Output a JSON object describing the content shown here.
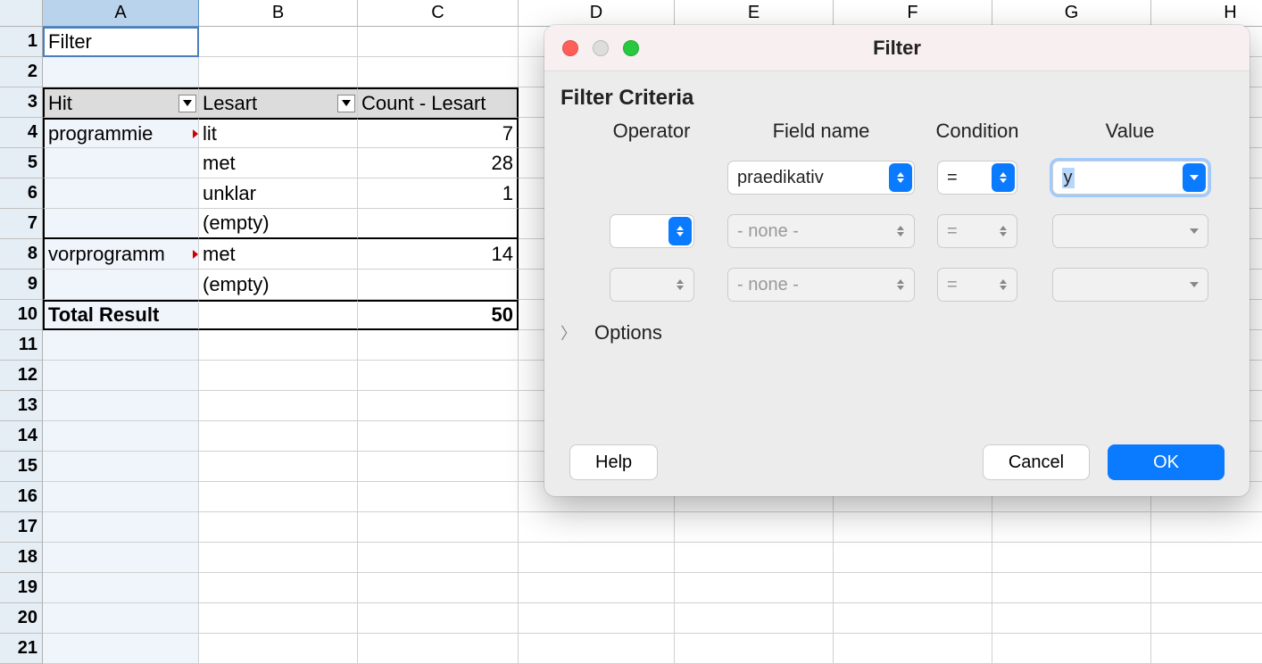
{
  "sheet": {
    "columns": [
      "A",
      "B",
      "C",
      "D",
      "E",
      "F",
      "G",
      "H"
    ],
    "row_numbers": [
      "1",
      "2",
      "3",
      "4",
      "5",
      "6",
      "7",
      "8",
      "9",
      "10",
      "11",
      "12",
      "13",
      "14",
      "15",
      "16",
      "17",
      "18",
      "19",
      "20",
      "21"
    ],
    "a1": "Filter",
    "pivot": {
      "headers": {
        "hit": "Hit",
        "lesart": "Lesart",
        "count": "Count - Lesart"
      },
      "rows": [
        {
          "hit": "programmie",
          "lesart": "lit",
          "count": "7"
        },
        {
          "hit": "",
          "lesart": "met",
          "count": "28"
        },
        {
          "hit": "",
          "lesart": "unklar",
          "count": "1"
        },
        {
          "hit": "",
          "lesart": "(empty)",
          "count": ""
        },
        {
          "hit": "vorprogramm",
          "lesart": "met",
          "count": "14"
        },
        {
          "hit": "",
          "lesart": "(empty)",
          "count": ""
        }
      ],
      "total_label": "Total Result",
      "total_value": "50"
    }
  },
  "dialog": {
    "title": "Filter",
    "section": "Filter Criteria",
    "headers": {
      "operator": "Operator",
      "field": "Field name",
      "condition": "Condition",
      "value": "Value"
    },
    "rows": [
      {
        "operator": "",
        "field": "praedikativ",
        "condition": "=",
        "value": "y",
        "enabled": true
      },
      {
        "operator": "",
        "field": "- none -",
        "condition": "=",
        "value": "",
        "enabled": false
      },
      {
        "operator": "",
        "field": "- none -",
        "condition": "=",
        "value": "",
        "enabled": false
      }
    ],
    "options_label": "Options",
    "buttons": {
      "help": "Help",
      "cancel": "Cancel",
      "ok": "OK"
    }
  }
}
